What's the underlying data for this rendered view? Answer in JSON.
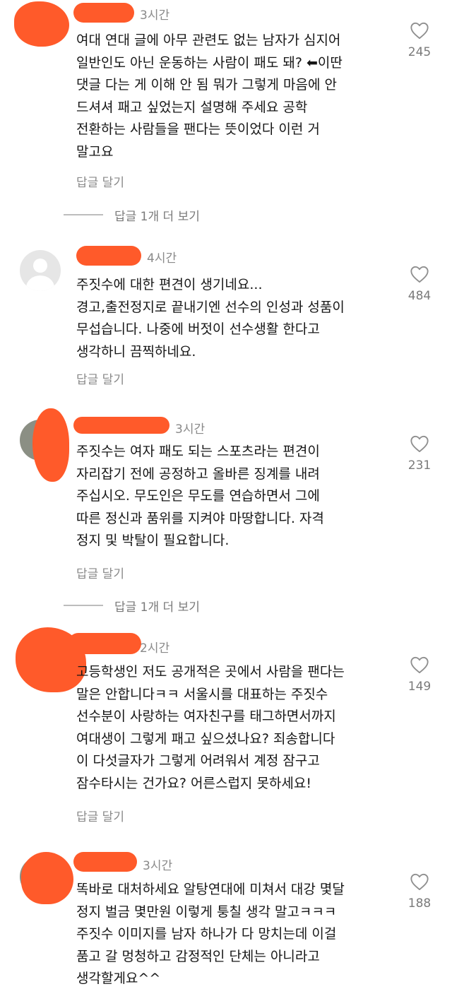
{
  "comments": [
    {
      "time": "3시간",
      "text": "여대 연대 글에 아무 관련도 없는 남자가 심지어\n일반인도 아닌 운동하는 사람이 패도 돼? ⬅이딴\n댓글 다는 게 이해 안 됨 뭐가 그렇게 마음에 안\n드셔셔 패고 싶었는지 설명해 주세요 공학\n전환하는 사람들을 팬다는 뜻이었다 이런 거\n말고요",
      "reply_label": "답글 달기",
      "likes": "245",
      "more_replies": "답글 1개 더 보기"
    },
    {
      "time": "4시간",
      "text": "주짓수에 대한 편견이 생기네요...\n경고,출전정지로 끝내기엔 선수의 인성과 성품이\n무섭습니다. 나중에 버젓이 선수생활 한다고\n생각하니 끔찍하네요.",
      "reply_label": "답글 달기",
      "likes": "484"
    },
    {
      "time": "3시간",
      "text": "주짓수는 여자 패도 되는 스포츠라는 편견이\n자리잡기 전에 공정하고 올바른 징계를 내려\n주십시오. 무도인은 무도를 연습하면서 그에\n따른 정신과 품위를 지켜야 마땅합니다. 자격\n정지 및 박탈이 필요합니다.",
      "reply_label": "답글 달기",
      "likes": "231",
      "more_replies": "답글 1개 더 보기"
    },
    {
      "time": "2시간",
      "text": "고등학생인 저도 공개적은 곳에서 사람을 팬다는\n말은 안합니다ㅋㅋ 서울시를 대표하는 주짓수\n선수분이 사랑하는 여자친구를 태그하면서까지\n여대생이 그렇게 패고 싶으셨나요? 죄송합니다\n이 다섯글자가 그렇게 어려워서 계정 잠구고\n잠수타시는 건가요? 어른스럽지 못하세요!",
      "reply_label": "답글 달기",
      "likes": "149"
    },
    {
      "time": "3시간",
      "text": "똑바로 대처하세요 알탕연대에 미쳐서 대강 몇달\n정지 벌금 몇만원 이렇게 퉁칠 생각 말고ㅋㅋㅋ\n주짓수 이미지를 남자 하나가 다 망치는데 이걸\n품고 갈 멍청하고 감정적인 단체는 아니라고\n생각할게요^^",
      "likes": "188"
    }
  ],
  "colors": {
    "redaction": "#ff5a2a",
    "meta_text": "#8a8a8a",
    "body_text": "#161616"
  },
  "icons": {
    "like": "heart-outline-icon",
    "avatar_default": "default-avatar-icon"
  }
}
